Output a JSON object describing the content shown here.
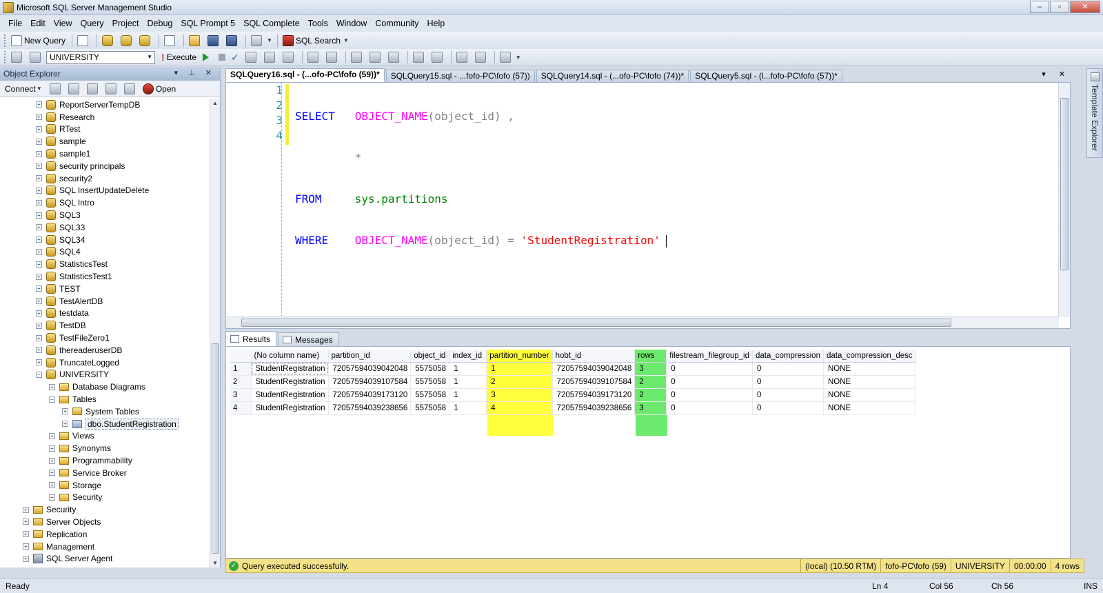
{
  "window": {
    "title": "Microsoft SQL Server Management Studio",
    "controls": [
      "–",
      "▫",
      "✕"
    ]
  },
  "menu": [
    "File",
    "Edit",
    "View",
    "Query",
    "Project",
    "Debug",
    "SQL Prompt 5",
    "SQL Complete",
    "Tools",
    "Window",
    "Community",
    "Help"
  ],
  "toolbar": {
    "new_query": "New Query",
    "sql_search": "SQL Search",
    "database": "UNIVERSITY",
    "execute": "Execute"
  },
  "object_explorer": {
    "title": "Object Explorer",
    "header_controls": "▾ ⊥ ✕",
    "connect": "Connect",
    "open": "Open",
    "tree": [
      {
        "label": "ReportServerTempDB",
        "level": 1,
        "icon": "db",
        "exp": "+"
      },
      {
        "label": "Research",
        "level": 1,
        "icon": "db",
        "exp": "+"
      },
      {
        "label": "RTest",
        "level": 1,
        "icon": "db",
        "exp": "+"
      },
      {
        "label": "sample",
        "level": 1,
        "icon": "db",
        "exp": "+"
      },
      {
        "label": "sample1",
        "level": 1,
        "icon": "db",
        "exp": "+"
      },
      {
        "label": "security principals",
        "level": 1,
        "icon": "db",
        "exp": "+"
      },
      {
        "label": "security2",
        "level": 1,
        "icon": "db",
        "exp": "+"
      },
      {
        "label": "SQL InsertUpdateDelete",
        "level": 1,
        "icon": "db",
        "exp": "+"
      },
      {
        "label": "SQL Intro",
        "level": 1,
        "icon": "db",
        "exp": "+"
      },
      {
        "label": "SQL3",
        "level": 1,
        "icon": "db",
        "exp": "+"
      },
      {
        "label": "SQL33",
        "level": 1,
        "icon": "db",
        "exp": "+"
      },
      {
        "label": "SQL34",
        "level": 1,
        "icon": "db",
        "exp": "+"
      },
      {
        "label": "SQL4",
        "level": 1,
        "icon": "db",
        "exp": "+"
      },
      {
        "label": "StatisticsTest",
        "level": 1,
        "icon": "db",
        "exp": "+"
      },
      {
        "label": "StatisticsTest1",
        "level": 1,
        "icon": "db",
        "exp": "+"
      },
      {
        "label": "TEST",
        "level": 1,
        "icon": "db",
        "exp": "+"
      },
      {
        "label": "TestAlertDB",
        "level": 1,
        "icon": "db",
        "exp": "+"
      },
      {
        "label": "testdata",
        "level": 1,
        "icon": "db",
        "exp": "+"
      },
      {
        "label": "TestDB",
        "level": 1,
        "icon": "db",
        "exp": "+"
      },
      {
        "label": "TestFileZero1",
        "level": 1,
        "icon": "db",
        "exp": "+"
      },
      {
        "label": "thereaderuserDB",
        "level": 1,
        "icon": "db",
        "exp": "+"
      },
      {
        "label": "TruncateLogged",
        "level": 1,
        "icon": "db",
        "exp": "+"
      },
      {
        "label": "UNIVERSITY",
        "level": 1,
        "icon": "db",
        "exp": "−"
      },
      {
        "label": "Database Diagrams",
        "level": 2,
        "icon": "folder",
        "exp": "+"
      },
      {
        "label": "Tables",
        "level": 2,
        "icon": "folder",
        "exp": "−"
      },
      {
        "label": "System Tables",
        "level": 3,
        "icon": "folder",
        "exp": "+"
      },
      {
        "label": "dbo.StudentRegistration",
        "level": 3,
        "icon": "table",
        "exp": "+",
        "selected": true
      },
      {
        "label": "Views",
        "level": 2,
        "icon": "folder",
        "exp": "+"
      },
      {
        "label": "Synonyms",
        "level": 2,
        "icon": "folder",
        "exp": "+"
      },
      {
        "label": "Programmability",
        "level": 2,
        "icon": "folder",
        "exp": "+"
      },
      {
        "label": "Service Broker",
        "level": 2,
        "icon": "folder",
        "exp": "+"
      },
      {
        "label": "Storage",
        "level": 2,
        "icon": "folder",
        "exp": "+"
      },
      {
        "label": "Security",
        "level": 2,
        "icon": "folder",
        "exp": "+"
      },
      {
        "label": "Security",
        "level": 0,
        "icon": "folder",
        "exp": "+"
      },
      {
        "label": "Server Objects",
        "level": 0,
        "icon": "folder",
        "exp": "+"
      },
      {
        "label": "Replication",
        "level": 0,
        "icon": "folder",
        "exp": "+"
      },
      {
        "label": "Management",
        "level": 0,
        "icon": "folder",
        "exp": "+"
      },
      {
        "label": "SQL Server Agent",
        "level": 0,
        "icon": "agent",
        "exp": "+"
      }
    ]
  },
  "doc_tabs": [
    {
      "label": "SQLQuery16.sql - (...ofo-PC\\fofo (59))*",
      "active": true
    },
    {
      "label": "SQLQuery15.sql - ...fofo-PC\\fofo (57))",
      "active": false
    },
    {
      "label": "SQLQuery14.sql - (...ofo-PC\\fofo (74))*",
      "active": false
    },
    {
      "label": "SQLQuery5.sql - (l...fofo-PC\\fofo (57))*",
      "active": false
    }
  ],
  "doc_tab_controls": "▾ ✕",
  "editor": {
    "line_numbers": [
      "1",
      "2",
      "3",
      "4"
    ],
    "code": {
      "l1_kw": "SELECT",
      "l1_fn": "OBJECT_NAME",
      "l1_args": "(object_id) ,",
      "l2_star": "*",
      "l3_kw": "FROM",
      "l3_sys": "sys.partitions",
      "l4_kw": "WHERE",
      "l4_fn": "OBJECT_NAME",
      "l4_args": "(object_id) =",
      "l4_str": "'StudentRegistration'"
    }
  },
  "result_tabs": [
    "Results",
    "Messages"
  ],
  "results": {
    "columns": [
      "",
      "(No column name)",
      "partition_id",
      "object_id",
      "index_id",
      "partition_number",
      "hobt_id",
      "rows",
      "filestream_filegroup_id",
      "data_compression",
      "data_compression_desc"
    ],
    "rows": [
      [
        "1",
        "StudentRegistration",
        "72057594039042048",
        "5575058",
        "1",
        "1",
        "72057594039042048",
        "3",
        "0",
        "0",
        "NONE"
      ],
      [
        "2",
        "StudentRegistration",
        "72057594039107584",
        "5575058",
        "1",
        "2",
        "72057594039107584",
        "2",
        "0",
        "0",
        "NONE"
      ],
      [
        "3",
        "StudentRegistration",
        "72057594039173120",
        "5575058",
        "1",
        "3",
        "72057594039173120",
        "2",
        "0",
        "0",
        "NONE"
      ],
      [
        "4",
        "StudentRegistration",
        "72057594039238656",
        "5575058",
        "1",
        "4",
        "72057594039238656",
        "3",
        "0",
        "0",
        "NONE"
      ]
    ],
    "highlight_colors": {
      "partition_number": "#ffff3b",
      "rows": "#6dea6d"
    }
  },
  "query_status": {
    "message": "Query executed successfully.",
    "server": "(local) (10.50 RTM)",
    "user": "fofo-PC\\fofo (59)",
    "database": "UNIVERSITY",
    "time": "00:00:00",
    "rows": "4 rows"
  },
  "template_explorer": "Template Explorer",
  "statusbar": {
    "ready": "Ready",
    "ln": "Ln 4",
    "col": "Col 56",
    "ch": "Ch 56",
    "ins": "INS"
  }
}
